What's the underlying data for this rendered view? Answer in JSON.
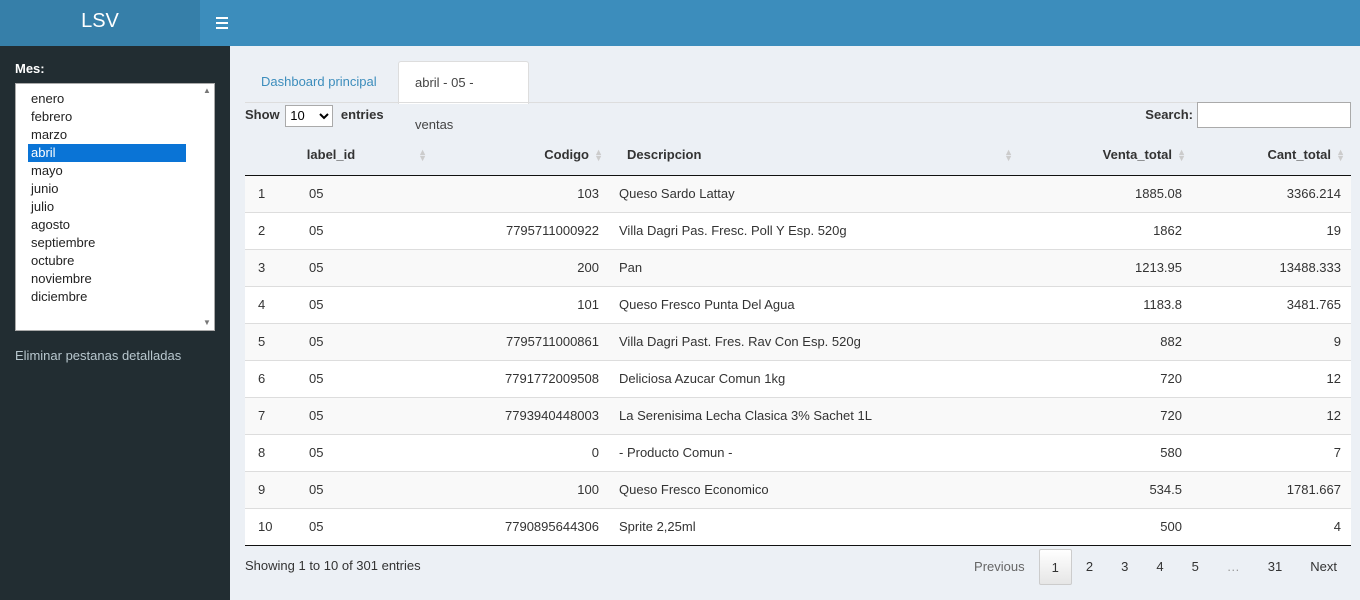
{
  "app": {
    "title": "LSV"
  },
  "sidebar": {
    "mes_label": "Mes:",
    "months": [
      "enero",
      "febrero",
      "marzo",
      "abril",
      "mayo",
      "junio",
      "julio",
      "agosto",
      "septiembre",
      "octubre",
      "noviembre",
      "diciembre"
    ],
    "selected_month": "abril",
    "link": "Eliminar pestanas detalladas"
  },
  "tabs": [
    {
      "label": "Dashboard principal",
      "active": false
    },
    {
      "label": "abril - 05 - ventas",
      "active": true
    }
  ],
  "table": {
    "show_label": "Show",
    "page_size": "10",
    "entries_label": "entries",
    "search_label": "Search:",
    "columns": [
      "",
      "label_id",
      "Codigo",
      "Descripcion",
      "Venta_total",
      "Cant_total"
    ],
    "rows": [
      [
        "1",
        "05",
        "103",
        "Queso Sardo Lattay",
        "1885.08",
        "3366.214"
      ],
      [
        "2",
        "05",
        "7795711000922",
        "Villa Dagri Pas. Fresc. Poll Y Esp. 520g",
        "1862",
        "19"
      ],
      [
        "3",
        "05",
        "200",
        "Pan",
        "1213.95",
        "13488.333"
      ],
      [
        "4",
        "05",
        "101",
        "Queso Fresco Punta Del Agua",
        "1183.8",
        "3481.765"
      ],
      [
        "5",
        "05",
        "7795711000861",
        "Villa Dagri Past. Fres. Rav Con Esp. 520g",
        "882",
        "9"
      ],
      [
        "6",
        "05",
        "7791772009508",
        "Deliciosa Azucar Comun 1kg",
        "720",
        "12"
      ],
      [
        "7",
        "05",
        "7793940448003",
        "La Serenisima Lecha Clasica 3% Sachet 1L",
        "720",
        "12"
      ],
      [
        "8",
        "05",
        "0",
        "- Producto Comun -",
        "580",
        "7"
      ],
      [
        "9",
        "05",
        "100",
        "Queso Fresco Economico",
        "534.5",
        "1781.667"
      ],
      [
        "10",
        "05",
        "7790895644306",
        "Sprite 2,25ml",
        "500",
        "4"
      ]
    ],
    "info": "Showing 1 to 10 of 301 entries",
    "pagination": {
      "previous": "Previous",
      "pages": [
        "1",
        "2",
        "3",
        "4",
        "5"
      ],
      "ellipsis": "…",
      "last": "31",
      "next": "Next",
      "current": "1"
    }
  }
}
